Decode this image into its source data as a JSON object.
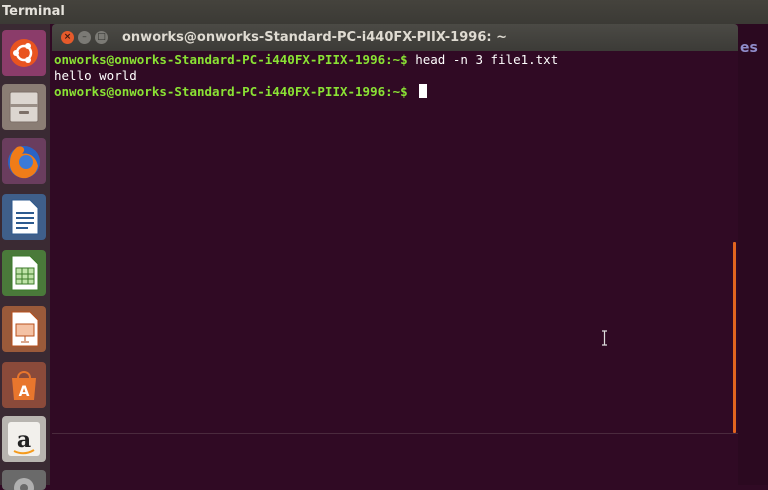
{
  "panel": {
    "app_name": "Terminal"
  },
  "window": {
    "title": "onworks@onworks-Standard-PC-i440FX-PIIX-1996: ~",
    "close_glyph": "×",
    "min_glyph": "–",
    "max_glyph": "□"
  },
  "terminal": {
    "lines": [
      {
        "prompt": "onworks@onworks-Standard-PC-i440FX-PIIX-1996:~$ ",
        "command": "head -n 3 file1.txt"
      },
      {
        "output": "hello world"
      },
      {
        "prompt": "onworks@onworks-Standard-PC-i440FX-PIIX-1996:~$ ",
        "command": ""
      }
    ]
  },
  "desktop_peek": {
    "text": "es"
  },
  "launcher": {
    "items": [
      {
        "name": "ubuntu-dash-icon"
      },
      {
        "name": "files-icon"
      },
      {
        "name": "firefox-icon"
      },
      {
        "name": "libreoffice-writer-icon"
      },
      {
        "name": "libreoffice-calc-icon"
      },
      {
        "name": "libreoffice-impress-icon"
      },
      {
        "name": "software-center-icon"
      },
      {
        "name": "amazon-icon"
      },
      {
        "name": "settings-icon"
      }
    ]
  },
  "colors": {
    "terminal_bg": "#300a24",
    "prompt": "#8ae234",
    "accent": "#e2651f"
  }
}
